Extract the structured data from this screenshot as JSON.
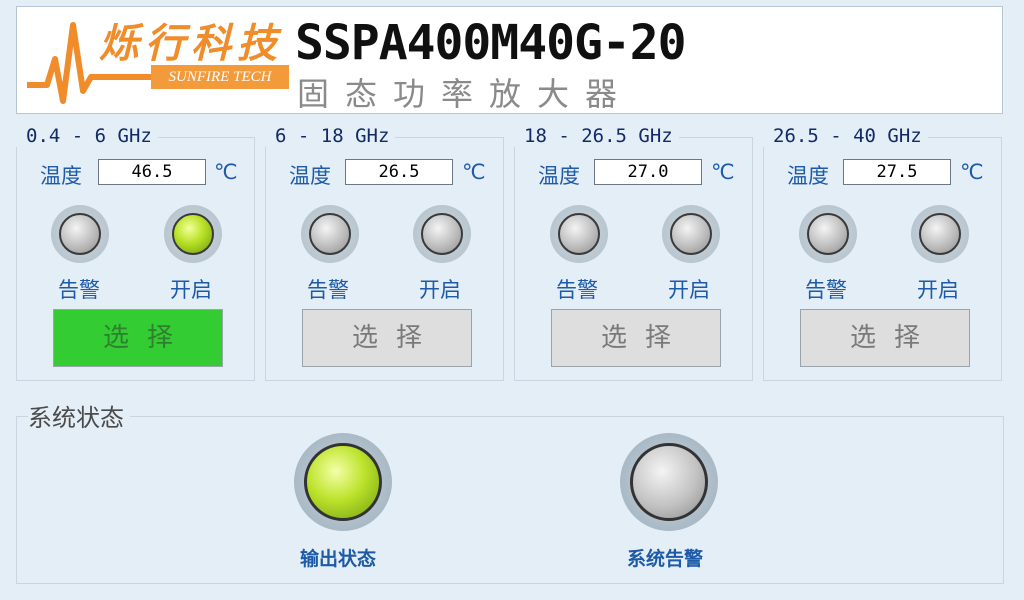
{
  "header": {
    "logo_cn": "烁行科技",
    "logo_en": "SUNFIRE TECH",
    "model": "SSPA400M40G-20",
    "subtitle": "固态功率放大器"
  },
  "colors": {
    "accent_green": "#33cc33",
    "label_blue": "#1d5aa8",
    "logo_orange": "#f08c2a"
  },
  "bands": [
    {
      "title": "0.4 - 6 GHz",
      "temp_label": "温度",
      "temp": "46.5",
      "unit": "℃",
      "alarm_label": "告警",
      "alarm_state": "off",
      "on_label": "开启",
      "on_state": "on",
      "select_label": "选择",
      "selected": true
    },
    {
      "title": "6 - 18 GHz",
      "temp_label": "温度",
      "temp": "26.5",
      "unit": "℃",
      "alarm_label": "告警",
      "alarm_state": "off",
      "on_label": "开启",
      "on_state": "off",
      "select_label": "选择",
      "selected": false
    },
    {
      "title": "18 - 26.5 GHz",
      "temp_label": "温度",
      "temp": "27.0",
      "unit": "℃",
      "alarm_label": "告警",
      "alarm_state": "off",
      "on_label": "开启",
      "on_state": "off",
      "select_label": "选择",
      "selected": false
    },
    {
      "title": "26.5 - 40 GHz",
      "temp_label": "温度",
      "temp": "27.5",
      "unit": "℃",
      "alarm_label": "告警",
      "alarm_state": "off",
      "on_label": "开启",
      "on_state": "off",
      "select_label": "选择",
      "selected": false
    }
  ],
  "system": {
    "title": "系统状态",
    "output_label": "输出状态",
    "output_state": "on",
    "alarm_label": "系统告警",
    "alarm_state": "off"
  }
}
